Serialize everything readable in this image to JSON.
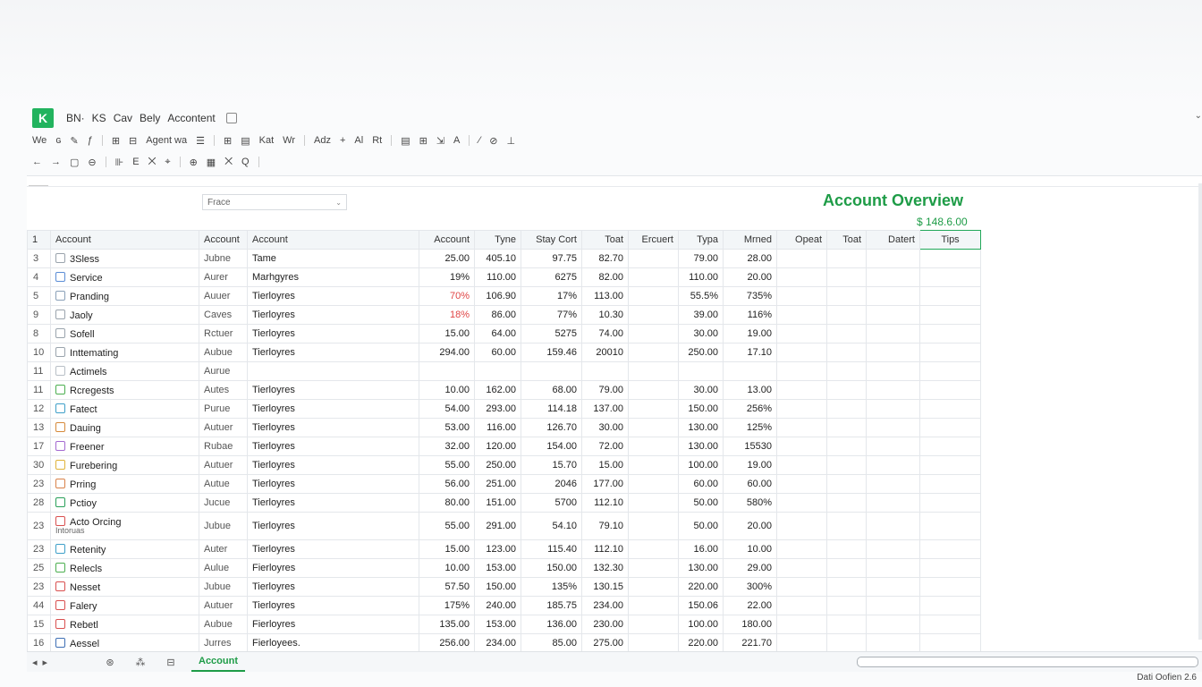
{
  "app": {
    "logo": "K",
    "title_parts": [
      "BN·",
      "KS",
      "Cav",
      "Bely",
      "Accontent"
    ]
  },
  "toolbar1": [
    "We",
    "ɢ",
    "✎",
    "ƒ",
    "⊞",
    "⊟",
    "Agent wa",
    "☰",
    "⊞",
    "▤",
    "Kat",
    "Wr",
    "Adz",
    "+",
    "Al",
    "Rt",
    "▤",
    "⊞",
    "⇲",
    "A",
    "⁄",
    "⊘",
    "⊥"
  ],
  "toolbar2": [
    "←",
    "→",
    "▢",
    "⊖",
    "⊪",
    "E",
    "⨉",
    "⌖",
    "⊕",
    "▦",
    "⨉",
    "Q"
  ],
  "formula": {
    "placeholder": "Frace"
  },
  "overview": {
    "title": "Account Overview",
    "amount": "$ 148.6.00"
  },
  "header_row": {
    "rownum": "1",
    "cols": [
      "Account",
      "Account",
      "Account",
      "Account",
      "Tyne",
      "Stay Cort",
      "Toat",
      "Ercuert",
      "Typa",
      "Mrned",
      "Opeat",
      "Toat",
      "Datert",
      "Tips"
    ]
  },
  "rows": [
    {
      "n": "3",
      "name": "3Sless",
      "icon": "#9aa4ad",
      "b": "Jubne",
      "c": "Tame",
      "d": "25.00",
      "e": "405.10",
      "f": "97.75",
      "g": "82.70",
      "h": "",
      "i": "79.00",
      "j": "28.00"
    },
    {
      "n": "4",
      "name": "Service",
      "icon": "#5b8dd6",
      "b": "Aurer",
      "c": "Marhgyres",
      "d": "19%",
      "e": "110.00",
      "f": "6275",
      "g": "82.00",
      "h": "",
      "i": "110.00",
      "j": "20.00"
    },
    {
      "n": "5",
      "name": "Pranding",
      "icon": "#8aa0b8",
      "b": "Auuer",
      "c": "Tierloyres",
      "d": "70%",
      "dred": true,
      "e": "106.90",
      "f": "17%",
      "g": "113.00",
      "h": "",
      "i": "55.5%",
      "j": "735%"
    },
    {
      "n": "9",
      "name": "Jaoly",
      "icon": "#9aa4ad",
      "b": "Caves",
      "c": "Tierloyres",
      "d": "18%",
      "dred": true,
      "e": "86.00",
      "f": "77%",
      "g": "10.30",
      "h": "",
      "i": "39.00",
      "j": "116%"
    },
    {
      "n": "8",
      "name": "Sofell",
      "icon": "#9aa4ad",
      "b": "Rctuer",
      "c": "Tierloyres",
      "d": "15.00",
      "e": "64.00",
      "f": "5275",
      "g": "74.00",
      "h": "",
      "i": "30.00",
      "j": "19.00"
    },
    {
      "n": "10",
      "name": "Inttemating",
      "icon": "#9aa4ad",
      "b": "Aubue",
      "c": "Tierloyres",
      "d": "294.00",
      "e": "60.00",
      "f": "159.46",
      "g": "20010",
      "h": "",
      "i": "250.00",
      "j": "17.10"
    },
    {
      "n": "11",
      "name": "Actimels",
      "icon": "#b8bfc6",
      "b": "Aurue",
      "c": "",
      "d": "",
      "e": "",
      "f": "",
      "g": "",
      "h": "",
      "i": "",
      "j": ""
    },
    {
      "n": "11",
      "name": "Rcregests",
      "icon": "#4caf50",
      "b": "Autes",
      "c": "Tierloyres",
      "d": "10.00",
      "e": "162.00",
      "f": "68.00",
      "g": "79.00",
      "h": "",
      "i": "30.00",
      "j": "13.00"
    },
    {
      "n": "12",
      "name": "Fatect",
      "icon": "#3fa0c9",
      "b": "Purue",
      "c": "Tierloyres",
      "d": "54.00",
      "e": "293.00",
      "f": "114.18",
      "g": "137.00",
      "h": "",
      "i": "150.00",
      "j": "256%"
    },
    {
      "n": "13",
      "name": "Dauing",
      "icon": "#d68a3b",
      "b": "Autuer",
      "c": "Tierloyres",
      "d": "53.00",
      "e": "116.00",
      "f": "126.70",
      "g": "30.00",
      "h": "",
      "i": "130.00",
      "j": "125%"
    },
    {
      "n": "17",
      "name": "Freener",
      "icon": "#a46ad1",
      "b": "Rubae",
      "c": "Tierloyres",
      "d": "32.00",
      "e": "120.00",
      "f": "154.00",
      "g": "72.00",
      "h": "",
      "i": "130.00",
      "j": "15530"
    },
    {
      "n": "30",
      "name": "Furebering",
      "icon": "#e0b33a",
      "b": "Autuer",
      "c": "Tierloyres",
      "d": "55.00",
      "e": "250.00",
      "f": "15.70",
      "g": "15.00",
      "h": "",
      "i": "100.00",
      "j": "19.00"
    },
    {
      "n": "23",
      "name": "Prring",
      "icon": "#d9824a",
      "b": "Autue",
      "c": "Tierloyres",
      "d": "56.00",
      "e": "251.00",
      "f": "2046",
      "g": "177.00",
      "h": "",
      "i": "60.00",
      "j": "60.00"
    },
    {
      "n": "28",
      "name": "Pctioy",
      "icon": "#2aa05a",
      "b": "Jucue",
      "c": "Tierloyres",
      "d": "80.00",
      "e": "151.00",
      "f": "5700",
      "g": "112.10",
      "h": "",
      "i": "50.00",
      "j": "580%"
    },
    {
      "n": "23",
      "name": "Acto Orcing",
      "sub": "Intoruas",
      "icon": "#d95050",
      "b": "Jubue",
      "c": "Tierloyres",
      "d": "55.00",
      "e": "291.00",
      "f": "54.10",
      "g": "79.10",
      "h": "",
      "i": "50.00",
      "j": "20.00"
    },
    {
      "n": "23",
      "name": "Retenity",
      "icon": "#3fa0c9",
      "b": "Auter",
      "c": "Tierloyres",
      "d": "15.00",
      "e": "123.00",
      "f": "115.40",
      "g": "112.10",
      "h": "",
      "i": "16.00",
      "j": "10.00"
    },
    {
      "n": "25",
      "name": "Relecls",
      "icon": "#4caf50",
      "b": "Aulue",
      "c": "Fierloyres",
      "d": "10.00",
      "e": "153.00",
      "f": "150.00",
      "g": "132.30",
      "h": "",
      "i": "130.00",
      "j": "29.00"
    },
    {
      "n": "23",
      "name": "Nesset",
      "icon": "#d95050",
      "b": "Jubue",
      "c": "Tierloyres",
      "d": "57.50",
      "e": "150.00",
      "f": "135%",
      "g": "130.15",
      "h": "",
      "i": "220.00",
      "j": "300%"
    },
    {
      "n": "44",
      "name": "Falery",
      "icon": "#d95050",
      "b": "Autuer",
      "c": "Tierloyres",
      "d": "175%",
      "e": "240.00",
      "f": "185.75",
      "g": "234.00",
      "h": "",
      "i": "150.06",
      "j": "22.00"
    },
    {
      "n": "15",
      "name": "Rebetl",
      "icon": "#d95050",
      "b": "Aubue",
      "c": "Fierloyres",
      "d": "135.00",
      "e": "153.00",
      "f": "136.00",
      "g": "230.00",
      "h": "",
      "i": "100.00",
      "j": "180.00"
    },
    {
      "n": "16",
      "name": "Aessel",
      "icon": "#3f6fb5",
      "b": "Jurres",
      "c": "Fierloyees.",
      "d": "256.00",
      "e": "234.00",
      "f": "85.00",
      "g": "275.00",
      "h": "",
      "i": "220.00",
      "j": "221.70"
    }
  ],
  "bottom": {
    "nav_left": "◂",
    "nav_right": "▸",
    "icons": [
      "⊛",
      "⁂",
      "⊟"
    ],
    "sheet_tab": "Account"
  },
  "status": {
    "text": "Dati Oofien 2.6"
  },
  "colors": {
    "accent": "#1e9c47",
    "red_value": "#e04545",
    "logo_bg": "#22b35e"
  }
}
